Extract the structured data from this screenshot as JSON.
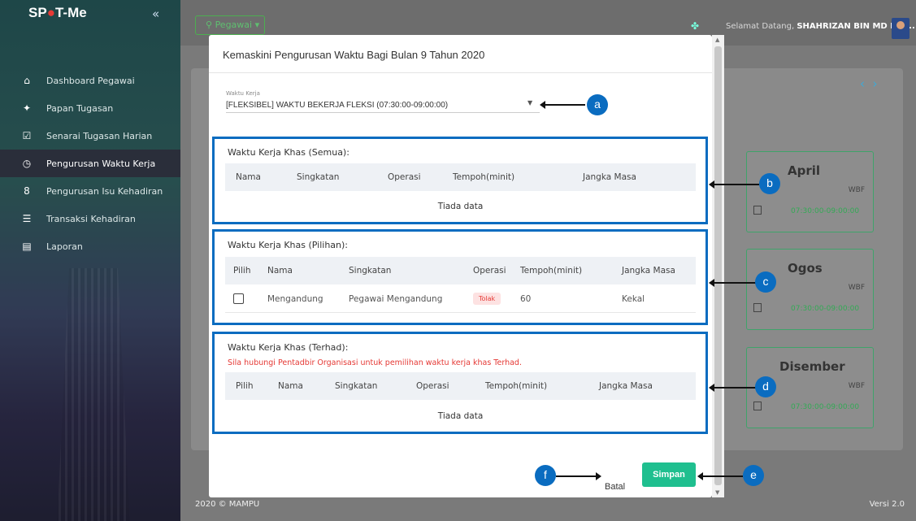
{
  "app": {
    "logo_prefix": "SP",
    "logo_dot": "●",
    "logo_suffix": "T-Me"
  },
  "sidebar": {
    "items": [
      {
        "label": "Dashboard Pegawai",
        "icon": "home-icon"
      },
      {
        "label": "Papan Tugasan",
        "icon": "puzzle-icon"
      },
      {
        "label": "Senarai Tugasan Harian",
        "icon": "checklist-icon"
      },
      {
        "label": "Pengurusan Waktu Kerja",
        "icon": "clock-icon",
        "active": true
      },
      {
        "label": "Pengurusan Isu Kehadiran",
        "icon": "person-icon"
      },
      {
        "label": "Transaksi Kehadiran",
        "icon": "list-icon"
      },
      {
        "label": "Laporan",
        "icon": "report-icon"
      }
    ]
  },
  "topbar": {
    "menu_label": "Pegawai",
    "welcome_prefix": "Selamat Datang,",
    "user_name": "SHAHRIZAN BIN MD RAJ..."
  },
  "background": {
    "months": [
      {
        "name": "April",
        "code": "WBF",
        "time": "07:30:00-09:00:00"
      },
      {
        "name": "Ogos",
        "code": "WBF",
        "time": "07:30:00-09:00:00"
      },
      {
        "name": "Disember",
        "code": "WBF",
        "time": "07:30:00-09:00:00"
      }
    ]
  },
  "modal": {
    "title": "Kemaskini Pengurusan Waktu Bagi Bulan 9 Tahun 2020",
    "waktu_kerja_label": "Waktu Kerja",
    "waktu_kerja_value": "[FLEKSIBEL] WAKTU BEKERJA FLEKSI (07:30:00-09:00:00)",
    "semua": {
      "title": "Waktu Kerja Khas (Semua):",
      "headers": [
        "Nama",
        "Singkatan",
        "Operasi",
        "Tempoh(minit)",
        "Jangka Masa"
      ],
      "empty": "Tiada data"
    },
    "pilihan": {
      "title": "Waktu Kerja Khas (Pilihan):",
      "headers": [
        "Pilih",
        "Nama",
        "Singkatan",
        "Operasi",
        "Tempoh(minit)",
        "Jangka Masa"
      ],
      "rows": [
        {
          "nama": "Mengandung",
          "singkatan": "Pegawai Mengandung",
          "operasi": "Tolak",
          "tempoh": "60",
          "jangka": "Kekal",
          "checked": false
        }
      ]
    },
    "terhad": {
      "title": "Waktu Kerja Khas (Terhad):",
      "warning": "Sila hubungi Pentadbir Organisasi untuk pemilihan waktu kerja khas Terhad.",
      "headers": [
        "Pilih",
        "Nama",
        "Singkatan",
        "Operasi",
        "Tempoh(minit)",
        "Jangka Masa"
      ],
      "empty": "Tiada data"
    },
    "cancel_label": "Batal",
    "save_label": "Simpan"
  },
  "annotations": {
    "a": "a",
    "b": "b",
    "c": "c",
    "d": "d",
    "e": "e",
    "f": "f"
  },
  "footer": {
    "copyright": "2020 © MAMPU",
    "version": "Versi 2.0"
  },
  "colors": {
    "accent_blue": "#0a6cc0",
    "save_green": "#1fbf8f",
    "warning_red": "#e53935"
  }
}
